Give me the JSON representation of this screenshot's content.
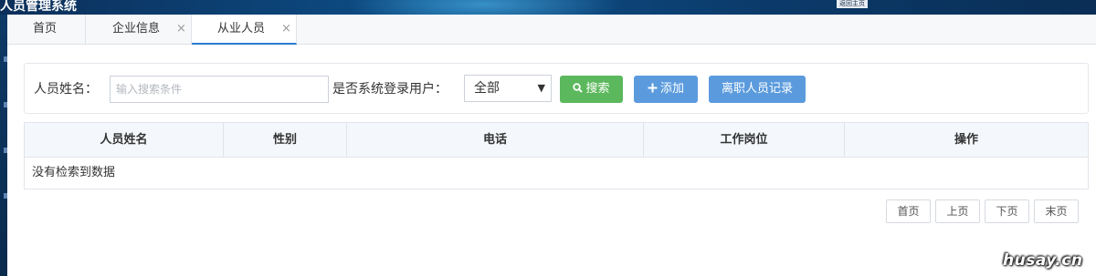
{
  "header": {
    "title": "人员管理系统",
    "badge": "返回主页"
  },
  "tabs": [
    {
      "label": "首页",
      "closable": false,
      "active": false
    },
    {
      "label": "企业信息",
      "closable": true,
      "active": false
    },
    {
      "label": "从业人员",
      "closable": true,
      "active": true
    }
  ],
  "tab_close_glyph": "×",
  "search": {
    "name_label": "人员姓名：",
    "name_placeholder": "输入搜索条件",
    "name_value": "",
    "login_label": "是否系统登录用户：",
    "login_selected": "全部",
    "search_button": "搜索",
    "add_button": "添加",
    "resigned_button": "离职人员记录"
  },
  "table": {
    "columns": [
      "人员姓名",
      "性别",
      "电话",
      "工作岗位",
      "操作"
    ],
    "empty_text": "没有检索到数据"
  },
  "pagination": [
    "首页",
    "上页",
    "下页",
    "末页"
  ],
  "watermark": "husay.cn",
  "colors": {
    "accent": "#2a7ccf",
    "green": "#5cb85c",
    "blue": "#5b9bdd"
  },
  "icons": {
    "search": "search-icon",
    "add": "plus-icon",
    "select": "chevron-down-icon"
  }
}
